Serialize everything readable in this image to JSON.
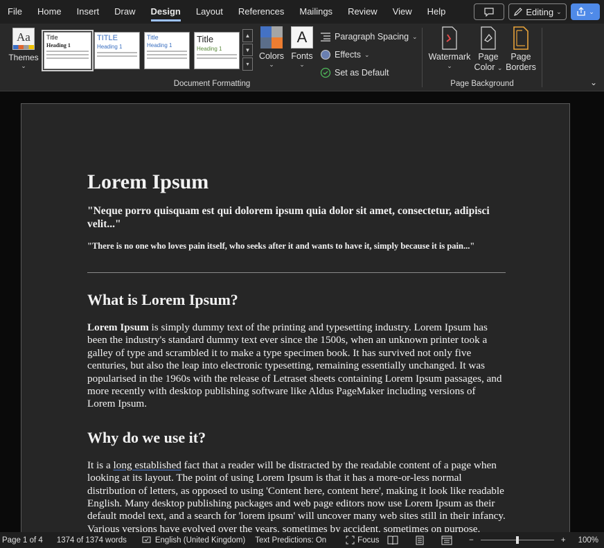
{
  "menu": {
    "items": [
      "File",
      "Home",
      "Insert",
      "Draw",
      "Design",
      "Layout",
      "References",
      "Mailings",
      "Review",
      "View",
      "Help"
    ],
    "active": "Design",
    "editing_label": "Editing"
  },
  "ribbon": {
    "themes_label": "Themes",
    "styles": [
      {
        "title": "Title",
        "heading": "Heading 1"
      },
      {
        "title": "TITLE",
        "heading": "Heading 1"
      },
      {
        "title": "Title",
        "heading": "Heading 1"
      },
      {
        "title": "Title",
        "heading": "Heading 1"
      }
    ],
    "colors_label": "Colors",
    "fonts_label": "Fonts",
    "fonts_glyph": "A",
    "paragraph_spacing_label": "Paragraph Spacing",
    "effects_label": "Effects",
    "set_default_label": "Set as Default",
    "group_document_formatting": "Document Formatting",
    "watermark_label": "Watermark",
    "page_color_label_1": "Page",
    "page_color_label_2": "Color",
    "page_borders_label_1": "Page",
    "page_borders_label_2": "Borders",
    "group_page_background": "Page Background",
    "accent_color": "#4f8ae8"
  },
  "document": {
    "title": "Lorem Ipsum",
    "quote1": "\"Neque porro quisquam est qui dolorem ipsum quia dolor sit amet, consectetur, adipisci velit...\"",
    "quote2": "\"There is no one who loves pain itself, who seeks after it and wants to have it, simply because it is pain...\"",
    "h2_what": "What is Lorem Ipsum?",
    "p1_bold": "Lorem Ipsum",
    "p1_rest": " is simply dummy text of the printing and typesetting industry. Lorem Ipsum has been the industry's standard dummy text ever since the 1500s, when an unknown printer took a galley of type and scrambled it to make a type specimen book. It has survived not only five centuries, but also the leap into electronic typesetting, remaining essentially unchanged. It was popularised in the 1960s with the release of Letraset sheets containing Lorem Ipsum passages, and more recently with desktop publishing software like Aldus PageMaker including versions of Lorem Ipsum.",
    "h2_why": "Why do we use it?",
    "p2_start": "It is a ",
    "p2_link": "long established",
    "p2_rest": " fact that a reader will be distracted by the readable content of a page when looking at its layout. The point of using Lorem Ipsum is that it has a more-or-less normal distribution of letters, as opposed to using 'Content here, content here', making it look like readable English. Many desktop publishing packages and web page editors now use Lorem Ipsum as their default model text, and a search for 'lorem ipsum' will uncover many web sites still in their infancy. Various versions have evolved over the years, sometimes by accident, sometimes on purpose."
  },
  "status": {
    "page": "Page 1 of 4",
    "words": "1374 of 1374 words",
    "language": "English (United Kingdom)",
    "predictions": "Text Predictions: On",
    "focus": "Focus",
    "zoom": "100%",
    "zoom_minus": "−",
    "zoom_plus": "+",
    "zoom_fraction": 0.5
  }
}
